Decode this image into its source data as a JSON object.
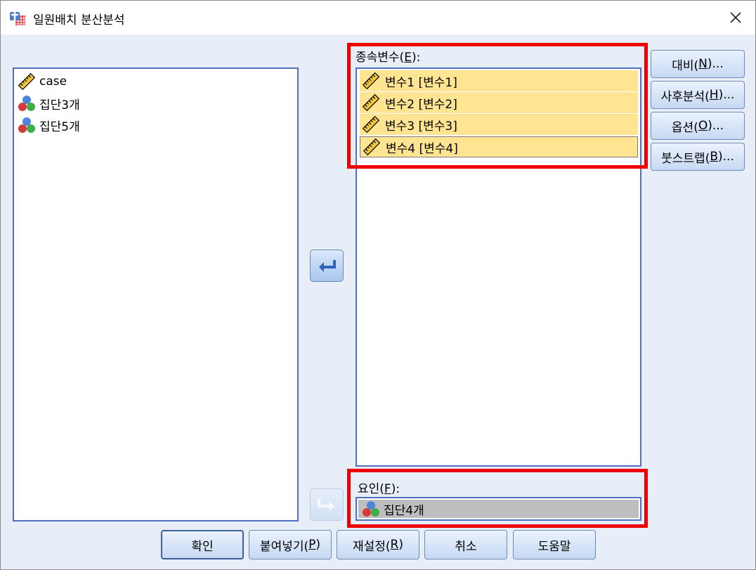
{
  "window": {
    "title": "일원배치 분산분석"
  },
  "source_list": {
    "items": [
      {
        "label": "case",
        "icon": "ruler-scale-icon"
      },
      {
        "label": "집단3개",
        "icon": "nominal-balls-icon"
      },
      {
        "label": "집단5개",
        "icon": "nominal-balls-icon"
      }
    ]
  },
  "dependent": {
    "label_prefix": "종속변수(",
    "mnemonic": "E",
    "label_suffix": "):",
    "items": [
      {
        "label": "변수1 [변수1]",
        "icon": "ruler-scale-icon"
      },
      {
        "label": "변수2 [변수2]",
        "icon": "ruler-scale-icon"
      },
      {
        "label": "변수3 [변수3]",
        "icon": "ruler-scale-icon"
      },
      {
        "label": "변수4 [변수4]",
        "icon": "ruler-scale-icon"
      }
    ]
  },
  "factor": {
    "label_prefix": "요인(",
    "mnemonic": "F",
    "label_suffix": "):",
    "value": "집단4개",
    "icon": "nominal-balls-icon"
  },
  "side_buttons": [
    {
      "prefix": "대비(",
      "mnemonic": "N",
      "suffix": ")..."
    },
    {
      "prefix": "사후분석(",
      "mnemonic": "H",
      "suffix": ")..."
    },
    {
      "prefix": "옵션(",
      "mnemonic": "O",
      "suffix": ")..."
    },
    {
      "prefix": "붓스트랩(",
      "mnemonic": "B",
      "suffix": ")..."
    }
  ],
  "bottom_buttons": {
    "ok": {
      "text": "확인"
    },
    "paste": {
      "prefix": "붙여넣기(",
      "mnemonic": "P",
      "suffix": ")"
    },
    "reset": {
      "prefix": "재설정(",
      "mnemonic": "R",
      "suffix": ")"
    },
    "cancel": {
      "text": "취소"
    },
    "help": {
      "text": "도움말"
    }
  },
  "colors": {
    "highlight": "#ee0000",
    "selection": "#ffe592",
    "factor_selection": "#bebebe"
  }
}
